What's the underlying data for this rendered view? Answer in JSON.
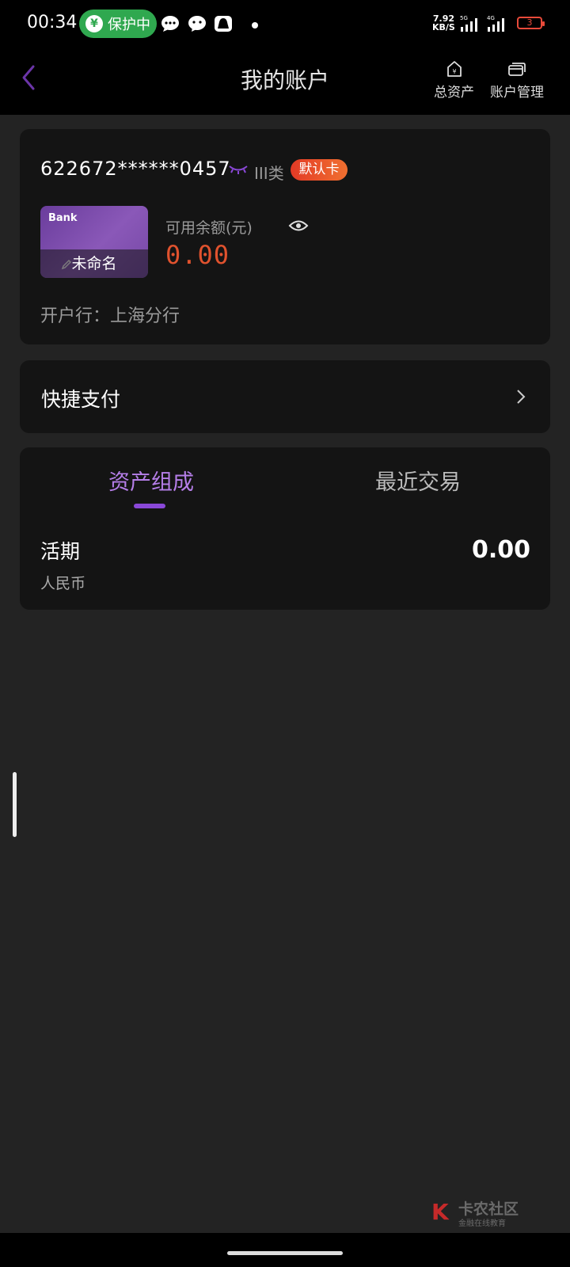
{
  "status_bar": {
    "time": "00:34",
    "protect_label": "保护中",
    "protect_icon": "¥",
    "speed_value": "7.92",
    "speed_unit": "KB/S",
    "sim1_label": "5G",
    "sim2_label": "4G",
    "battery": "3"
  },
  "header": {
    "title": "我的账户",
    "total_assets": "总资产",
    "total_assets_icon": "¥",
    "account_manage": "账户管理"
  },
  "account": {
    "number": "622672******0457",
    "class_label": "III类",
    "default_badge": "默认卡",
    "card_logo": "Bank",
    "card_name": "未命名",
    "balance_label": "可用余额(元)",
    "balance": "0.00",
    "bank_branch": "开户行：上海分行"
  },
  "quick_pay": {
    "label": "快捷支付"
  },
  "assets": {
    "tabs": [
      "资产组成",
      "最近交易"
    ],
    "active_tab": 0,
    "row": {
      "name": "活期",
      "currency": "人民币",
      "value": "0.00"
    }
  },
  "watermark": {
    "logo": "K",
    "title": "卡农社区",
    "subtitle": "金融在线教育"
  },
  "colors": {
    "accent": "#8a48d8",
    "balance": "#e0522e",
    "badge": "#e33a26",
    "protect": "#2fa84f"
  }
}
